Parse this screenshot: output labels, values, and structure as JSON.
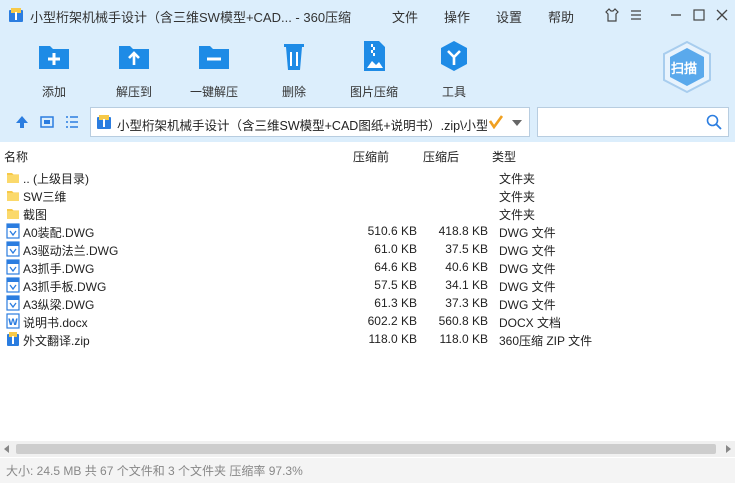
{
  "window": {
    "title": "小型桁架机械手设计（含三维SW模型+CAD... - 360压缩",
    "menus": [
      "文件",
      "操作",
      "设置",
      "帮助"
    ]
  },
  "toolbar": {
    "add": "添加",
    "extract_to": "解压到",
    "one_click_extract": "一键解压",
    "delete": "删除",
    "image_compress": "图片压缩",
    "tools": "工具",
    "scan": "扫描"
  },
  "address": {
    "path": "小型桁架机械手设计（含三维SW模型+CAD图纸+说明书）.zip\\小型桁"
  },
  "columns": {
    "name": "名称",
    "compressed": "压缩前",
    "size": "压缩后",
    "type": "类型"
  },
  "files": [
    {
      "name": ".. (上级目录)",
      "compressed": "",
      "size": "",
      "type": "文件夹",
      "icon": "folder-icon"
    },
    {
      "name": "SW三维",
      "compressed": "",
      "size": "",
      "type": "文件夹",
      "icon": "folder-icon"
    },
    {
      "name": "截图",
      "compressed": "",
      "size": "",
      "type": "文件夹",
      "icon": "folder-icon"
    },
    {
      "name": "A0装配.DWG",
      "compressed": "510.6 KB",
      "size": "418.8 KB",
      "type": "DWG 文件",
      "icon": "dwg-icon"
    },
    {
      "name": "A3驱动法兰.DWG",
      "compressed": "61.0 KB",
      "size": "37.5 KB",
      "type": "DWG 文件",
      "icon": "dwg-icon"
    },
    {
      "name": "A3抓手.DWG",
      "compressed": "64.6 KB",
      "size": "40.6 KB",
      "type": "DWG 文件",
      "icon": "dwg-icon"
    },
    {
      "name": "A3抓手板.DWG",
      "compressed": "57.5 KB",
      "size": "34.1 KB",
      "type": "DWG 文件",
      "icon": "dwg-icon"
    },
    {
      "name": "A3纵梁.DWG",
      "compressed": "61.3 KB",
      "size": "37.3 KB",
      "type": "DWG 文件",
      "icon": "dwg-icon"
    },
    {
      "name": "说明书.docx",
      "compressed": "602.2 KB",
      "size": "560.8 KB",
      "type": "DOCX 文档",
      "icon": "docx-icon"
    },
    {
      "name": "外文翻译.zip",
      "compressed": "118.0 KB",
      "size": "118.0 KB",
      "type": "360压缩 ZIP 文件",
      "icon": "zip-icon"
    }
  ],
  "status": {
    "text": "大小: 24.5 MB 共 67 个文件和 3 个文件夹 压缩率 97.3%"
  },
  "colors": {
    "chrome_bg": "#dceefc",
    "icon_blue": "#1e8be6",
    "folder_yellow": "#f7c948"
  }
}
